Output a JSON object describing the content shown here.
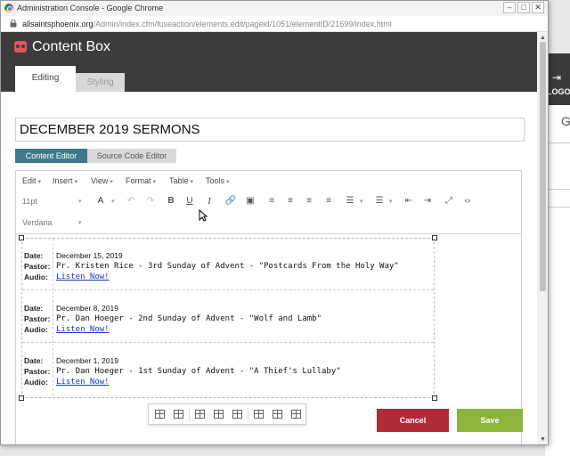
{
  "browser": {
    "window_title": "Administration Console - Google Chrome",
    "url_host": "allsaintsphoenix.org",
    "url_path": "/Admin/index.cfm/fuseaction/elements.edit/pageid/1051/elementID/21699/index.html"
  },
  "background": {
    "logout_label": "LOGOUT",
    "partial_letter": "G"
  },
  "header": {
    "title": "Content Box",
    "tabs": [
      {
        "label": "Editing",
        "active": true
      },
      {
        "label": "Styling",
        "active": false
      }
    ]
  },
  "title_field": {
    "value": "DECEMBER 2019 SERMONS"
  },
  "editor_modes": {
    "content": "Content Editor",
    "source": "Source Code Editor"
  },
  "editor": {
    "menus": [
      "Edit",
      "Insert",
      "View",
      "Format",
      "Table",
      "Tools"
    ],
    "font_size": "11pt",
    "font_family": "Verdana",
    "text_color_label": "A"
  },
  "labels": {
    "date": "Date:",
    "pastor": "Pastor:",
    "audio": "Audio:"
  },
  "sermons": [
    {
      "date": "December 15, 2019",
      "pastor": "Pr. Kristen Rice - 3rd Sunday of Advent - \"Postcards From the Holy Way\"",
      "audio": "Listen Now!"
    },
    {
      "date": "December 8, 2019",
      "pastor": "Pr. Dan Hoeger - 2nd Sunday of Advent - \"Wolf and Lamb\"",
      "audio": "Listen Now!"
    },
    {
      "date": "December 1, 2019",
      "pastor": "Pr. Dan Hoeger - 1st Sunday of Advent - \"A Thief's Lullaby\"",
      "audio": "Listen Now!"
    }
  ],
  "actions": {
    "cancel": "Cancel",
    "save": "Save"
  },
  "colors": {
    "header_bg": "#3c3c3c",
    "accent": "#e25561",
    "content_editor_tab": "#3f7a8c",
    "cancel": "#b02a3a",
    "save": "#8db43d",
    "link": "#1a35c4"
  }
}
